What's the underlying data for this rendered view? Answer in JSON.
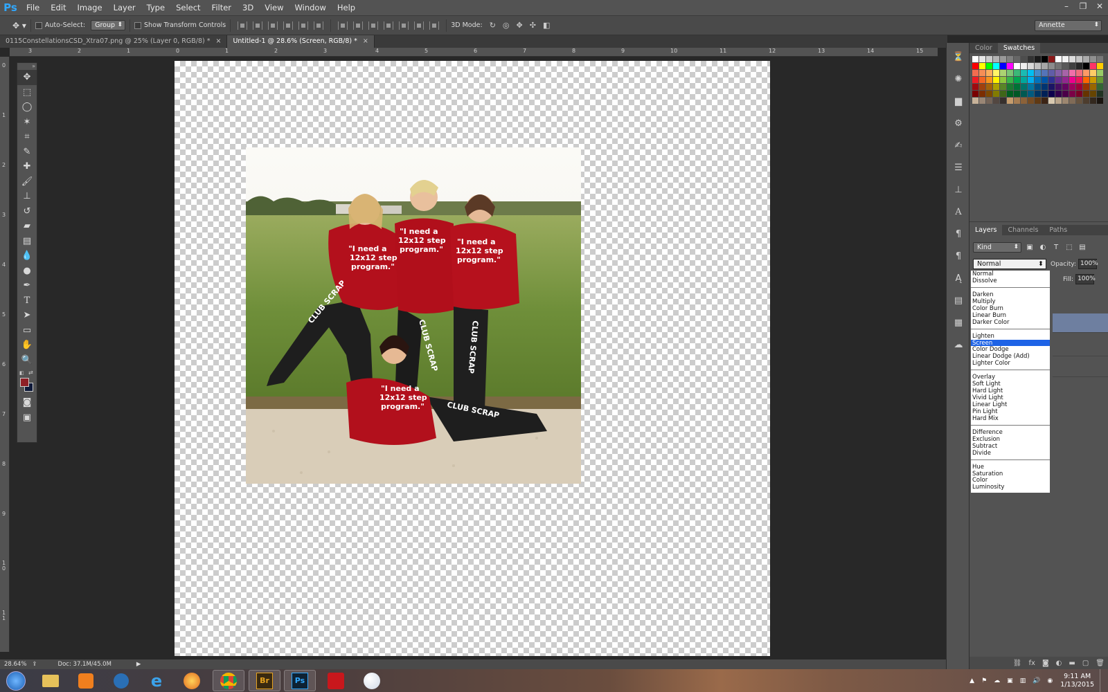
{
  "app": {
    "logo": "Ps",
    "menus": [
      "File",
      "Edit",
      "Image",
      "Layer",
      "Type",
      "Select",
      "Filter",
      "3D",
      "View",
      "Window",
      "Help"
    ]
  },
  "options_bar": {
    "auto_select_label": "Auto-Select:",
    "auto_select_value": "Group",
    "show_transform_label": "Show Transform Controls",
    "mode_3d_label": "3D Mode:",
    "workspace": "Annette"
  },
  "tabs": [
    {
      "title": "0115ConstellationsCSD_Xtra07.png @ 25% (Layer 0, RGB/8) *",
      "active": false
    },
    {
      "title": "Untitled-1 @ 28.6% (Screen, RGB/8) *",
      "active": true
    }
  ],
  "ruler": {
    "top": [
      "3",
      "2",
      "1",
      "0",
      "1",
      "2",
      "3",
      "4",
      "5",
      "6",
      "7",
      "8",
      "9",
      "10",
      "11",
      "12",
      "13",
      "14",
      "15"
    ],
    "left": [
      "0",
      "1",
      "2",
      "3",
      "4",
      "5",
      "6",
      "7",
      "8",
      "9",
      "1 0",
      "1 1"
    ]
  },
  "photo": {
    "shirt_text_1": "\"I need a",
    "shirt_text_2": "12x12 step",
    "shirt_text_3": "program.\"",
    "pants_text": "CLUB SCRAP"
  },
  "panels": {
    "top_tabs": [
      "Color",
      "Swatches"
    ],
    "active_top_tab": "Swatches",
    "layer_tabs": [
      "Layers",
      "Channels",
      "Paths"
    ],
    "active_layer_tab": "Layers",
    "kind_filter": "Kind",
    "blend_mode": "Normal",
    "opacity_label": "Opacity:",
    "opacity_value": "100%",
    "fill_label": "Fill:",
    "fill_value": "100%"
  },
  "blend_menu": {
    "groups": [
      [
        "Normal",
        "Dissolve"
      ],
      [
        "Darken",
        "Multiply",
        "Color Burn",
        "Linear Burn",
        "Darker Color"
      ],
      [
        "Lighten",
        "Screen",
        "Color Dodge",
        "Linear Dodge (Add)",
        "Lighter Color"
      ],
      [
        "Overlay",
        "Soft Light",
        "Hard Light",
        "Vivid Light",
        "Linear Light",
        "Pin Light",
        "Hard Mix"
      ],
      [
        "Difference",
        "Exclusion",
        "Subtract",
        "Divide"
      ],
      [
        "Hue",
        "Saturation",
        "Color",
        "Luminosity"
      ]
    ],
    "selected": "Screen"
  },
  "swatch_colors": [
    "#ffffff",
    "#e6e6e6",
    "#cccccc",
    "#b3b3b3",
    "#999999",
    "#808080",
    "#666666",
    "#4d4d4d",
    "#333333",
    "#1a1a1a",
    "#000000",
    "#8b1a1a",
    "#ffffff",
    "#f2f2f2",
    "#dcdcdc",
    "#c4c4c4",
    "#ababab",
    "#909090",
    "#787878",
    "#ff0000",
    "#ffff00",
    "#00ff00",
    "#00ffff",
    "#0000ff",
    "#ff00ff",
    "#ffffff",
    "#eeeeee",
    "#d9d9d9",
    "#c0c0c0",
    "#a6a6a6",
    "#8c8c8c",
    "#737373",
    "#595959",
    "#404040",
    "#262626",
    "#000000",
    "#ff3366",
    "#ffcc00",
    "#f26c4f",
    "#f68e55",
    "#fbaf5c",
    "#fff467",
    "#acd372",
    "#7cc576",
    "#3bb878",
    "#1abbb4",
    "#00bff3",
    "#438ccb",
    "#5574b9",
    "#605ca8",
    "#855fa8",
    "#a763a8",
    "#f06ea9",
    "#f26d7d",
    "#ff9966",
    "#ffcc66",
    "#99cc66",
    "#ed1c24",
    "#f26522",
    "#f7941d",
    "#fff200",
    "#8dc73f",
    "#39b54a",
    "#00a651",
    "#00a99d",
    "#00aeef",
    "#0072bc",
    "#0054a6",
    "#2e3192",
    "#662d91",
    "#92278f",
    "#ec008c",
    "#ed145b",
    "#ff6600",
    "#cc9900",
    "#669933",
    "#9e0b0f",
    "#a0410d",
    "#a36209",
    "#aba000",
    "#598527",
    "#1a7b30",
    "#007236",
    "#00746b",
    "#0076a3",
    "#004b80",
    "#003471",
    "#1b1464",
    "#440e62",
    "#630460",
    "#9e005d",
    "#9e0039",
    "#993300",
    "#996600",
    "#336633",
    "#790000",
    "#7b2e00",
    "#7d4900",
    "#827b00",
    "#406618",
    "#005e20",
    "#005826",
    "#005952",
    "#005b7f",
    "#003663",
    "#002157",
    "#0d004c",
    "#32004b",
    "#4b0049",
    "#7b0046",
    "#7a0026",
    "#663300",
    "#664400",
    "#223322",
    "#c7b299",
    "#998675",
    "#736357",
    "#534741",
    "#37302d",
    "#c69c6d",
    "#a67c52",
    "#8c6239",
    "#754c24",
    "#603913",
    "#3c2415",
    "#d8c9b0",
    "#b8a48a",
    "#9c8770",
    "#806b57",
    "#66533f",
    "#4d3d2e",
    "#33281e",
    "#1a140f"
  ],
  "status": {
    "zoom": "28.64%",
    "doc": "Doc: 37.1M/45.0M"
  },
  "taskbar": {
    "time": "9:11 AM",
    "date": "1/13/2015"
  }
}
